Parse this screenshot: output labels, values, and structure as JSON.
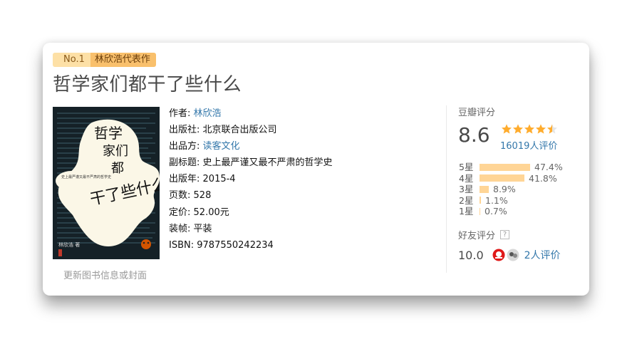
{
  "rank": {
    "no": "No.1",
    "text": "林欣浩代表作"
  },
  "book": {
    "title": "哲学家们都干了些什么",
    "cover_title": "哲学家们都干了些什么?",
    "cover_subtitle": "史上最严谨又最不严肃的哲学史",
    "cover_author": "林欣浩 著"
  },
  "info": {
    "author_label": "作者:",
    "author": "林欣浩",
    "publisher_label": "出版社:",
    "publisher": "北京联合出版公司",
    "producer_label": "出品方:",
    "producer": "读客文化",
    "subtitle_label": "副标题:",
    "subtitle": "史上最严谨又最不严肃的哲学史",
    "year_label": "出版年:",
    "year": "2015-4",
    "pages_label": "页数:",
    "pages": "528",
    "price_label": "定价:",
    "price": "52.00元",
    "binding_label": "装帧:",
    "binding": "平装",
    "isbn_label": "ISBN:",
    "isbn": "9787550242234"
  },
  "update_link": "更新图书信息或封面",
  "rating": {
    "label": "豆瓣评分",
    "score": "8.6",
    "stars": 4.5,
    "count": "16019人评价",
    "distribution": [
      {
        "label": "5星",
        "percent": "47.4%",
        "value": 47.4
      },
      {
        "label": "4星",
        "percent": "41.8%",
        "value": 41.8
      },
      {
        "label": "3星",
        "percent": "8.9%",
        "value": 8.9
      },
      {
        "label": "2星",
        "percent": "1.1%",
        "value": 1.1
      },
      {
        "label": "1星",
        "percent": "0.7%",
        "value": 0.7
      }
    ]
  },
  "friend_rating": {
    "label": "好友评分",
    "help": "?",
    "score": "10.0",
    "count": "2人评价"
  },
  "colors": {
    "link": "#3377aa",
    "star": "#ffac2d",
    "bar": "#ffd596",
    "rank_bg": "#fde0a6",
    "cover_bg": "#152127"
  }
}
